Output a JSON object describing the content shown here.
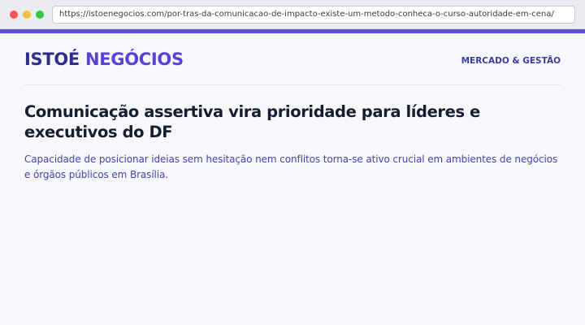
{
  "browser": {
    "url": "https://istoenegocios.com/por-tras-da-comunicacao-de-impacto-existe-um-metodo-conheca-o-curso-autoridade-em-cena/",
    "dot_colors": [
      "#fc5753",
      "#fdbc40",
      "#33c748"
    ]
  },
  "colors": {
    "accent": "#5b4fd8",
    "headline": "#1a1b33",
    "subtitle": "#4a3fb0",
    "logo_first": "#2e2f8c",
    "logo_second": "#5b3fd6"
  },
  "header": {
    "logo_first": "ISTOÉ",
    "logo_second": "NEGÓCIOS",
    "section_label": "MERCADO & GESTÃO"
  },
  "article": {
    "headline": "Comunicação assertiva vira prioridade para líderes e executivos do DF",
    "subtitle": "Capacidade de posicionar ideias sem hesitação nem conflitos torna-se ativo crucial em ambientes de negócios e órgãos públicos em Brasília."
  }
}
